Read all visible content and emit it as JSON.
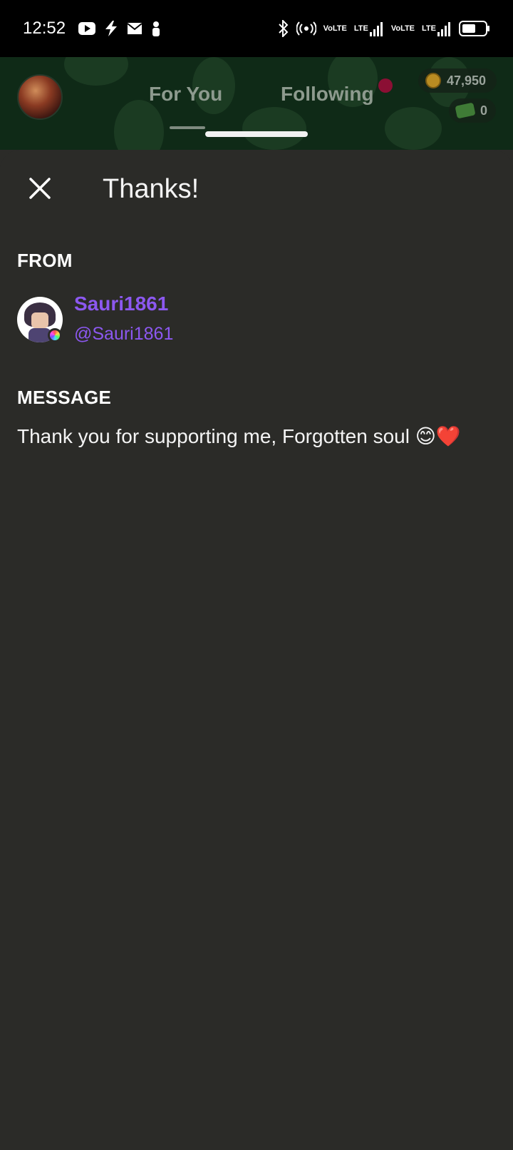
{
  "status_bar": {
    "time": "12:52",
    "left_icons": [
      "youtube-icon",
      "bolt-icon",
      "mail-icon",
      "person-icon"
    ],
    "right_icons": [
      "bluetooth-icon",
      "hotspot-icon",
      "volte-icon",
      "signal-icon",
      "volte-icon-2",
      "signal-icon-2",
      "battery-icon"
    ],
    "network1_top": "Vo",
    "network1_bottom": "LTE",
    "network2_top": "Vo",
    "network2_bottom": "LTE",
    "lte_label_1": "LTE",
    "lte_label_2": "LTE"
  },
  "header": {
    "tabs": [
      {
        "label": "For You",
        "active": true
      },
      {
        "label": "Following",
        "active": false
      }
    ],
    "coins": "47,950",
    "gems": "0"
  },
  "sheet": {
    "title": "Thanks!",
    "from_label": "FROM",
    "sender": {
      "name": "Sauri1861",
      "handle": "@Sauri1861"
    },
    "message_label": "MESSAGE",
    "message": "Thank you for supporting me, Forgotten soul 😊❤️"
  },
  "colors": {
    "accent": "#8c58f0",
    "background": "#2b2b28",
    "header_bg": "#0f2a17"
  }
}
